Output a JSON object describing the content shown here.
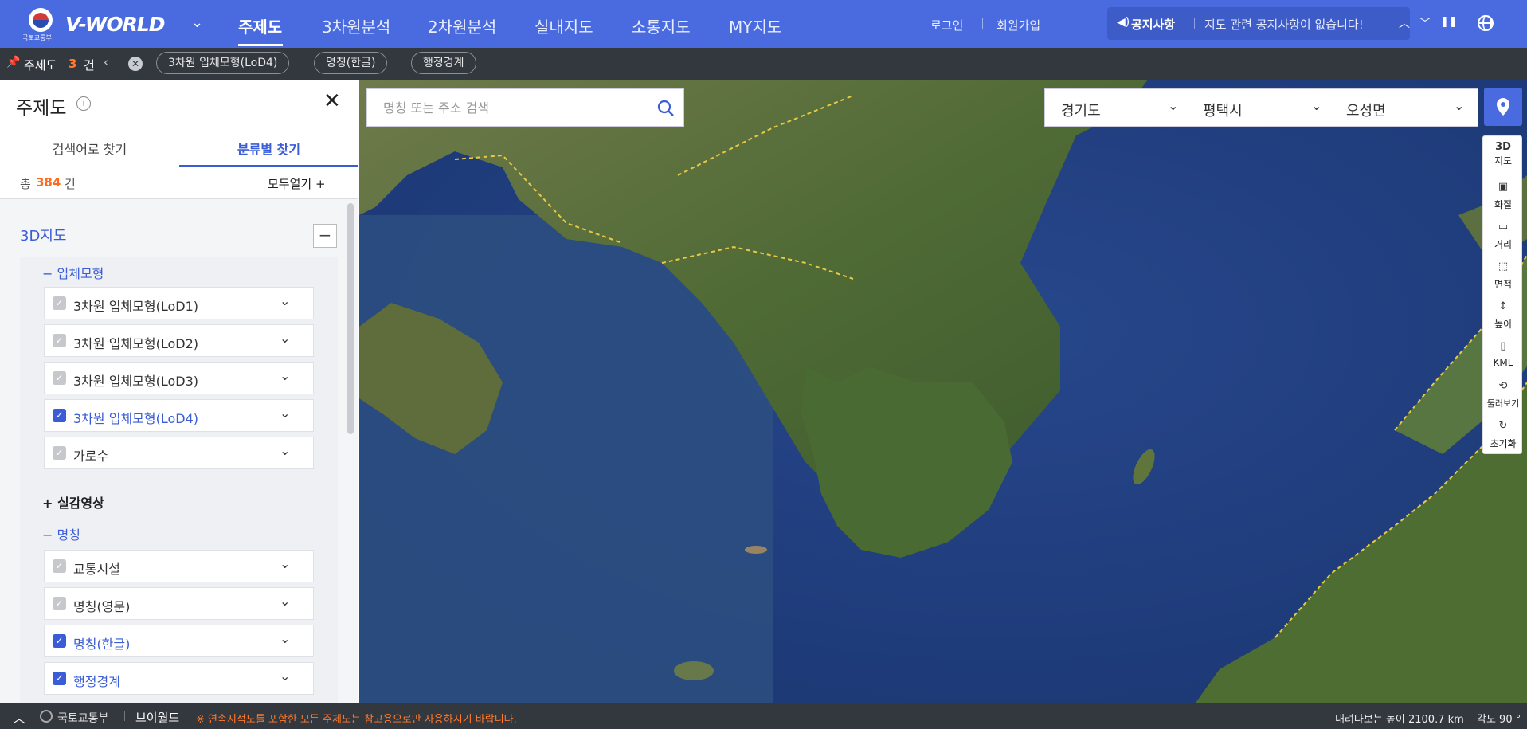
{
  "header": {
    "logo_sub": "국토교통부",
    "logo_text": "V-WORLD",
    "nav": [
      "주제도",
      "3차원분석",
      "2차원분석",
      "실내지도",
      "소통지도",
      "MY지도"
    ],
    "login": "로그인",
    "signup": "회원가입",
    "notice_label": "공지사항",
    "notice_text": "지도 관련 공지사항이 없습니다!"
  },
  "chipbar": {
    "title": "주제도",
    "count": "3",
    "unit": "건",
    "chips": [
      "3차원 입체모형(LoD4)",
      "명칭(한글)",
      "행정경계"
    ]
  },
  "panel": {
    "title": "주제도",
    "tabs": [
      "검색어로 찾기",
      "분류별 찾기"
    ],
    "total_prefix": "총",
    "total_count": "384",
    "total_unit": "건",
    "expand_all": "모두열기 +",
    "section": "3D지도",
    "groups": [
      {
        "title": "입체모형",
        "items": [
          {
            "label": "3차원 입체모형(LoD1)",
            "checked": false
          },
          {
            "label": "3차원 입체모형(LoD2)",
            "checked": false
          },
          {
            "label": "3차원 입체모형(LoD3)",
            "checked": false
          },
          {
            "label": "3차원 입체모형(LoD4)",
            "checked": true
          },
          {
            "label": "가로수",
            "checked": false
          }
        ]
      },
      {
        "title": "실감영상",
        "items": []
      },
      {
        "title": "명칭",
        "items": [
          {
            "label": "교통시설",
            "checked": false
          },
          {
            "label": "명칭(영문)",
            "checked": false
          },
          {
            "label": "명칭(한글)",
            "checked": true
          },
          {
            "label": "행정경계",
            "checked": true
          }
        ]
      }
    ]
  },
  "map": {
    "search_placeholder": "명칭 또는 주소 검색",
    "region": [
      "경기도",
      "평택시",
      "오성면"
    ],
    "tools": [
      {
        "icon": "3d-map-icon",
        "line1": "3D",
        "label": "지도"
      },
      {
        "icon": "quality-icon",
        "line1": "",
        "label": "화질"
      },
      {
        "icon": "ruler-icon",
        "line1": "",
        "label": "거리"
      },
      {
        "icon": "area-icon",
        "line1": "",
        "label": "면적"
      },
      {
        "icon": "height-icon",
        "line1": "",
        "label": "높이"
      },
      {
        "icon": "file-icon",
        "line1": "",
        "label": "KML"
      },
      {
        "icon": "orbit-icon",
        "line1": "",
        "label": "둘러보기"
      },
      {
        "icon": "reset-icon",
        "line1": "",
        "label": "초기화"
      }
    ]
  },
  "footer": {
    "ministry": "국토교통부",
    "brand": "브이월드",
    "warning": "※ 연속지적도를 포함한 모든 주제도는 참고용으로만 사용하시기 바랍니다.",
    "altitude": "내려다보는 높이 2100.7 km",
    "angle": "각도 90 °"
  },
  "colors": {
    "primary": "#4a6be0",
    "accent": "#ff6a1a",
    "dark_bar": "#33373e"
  }
}
